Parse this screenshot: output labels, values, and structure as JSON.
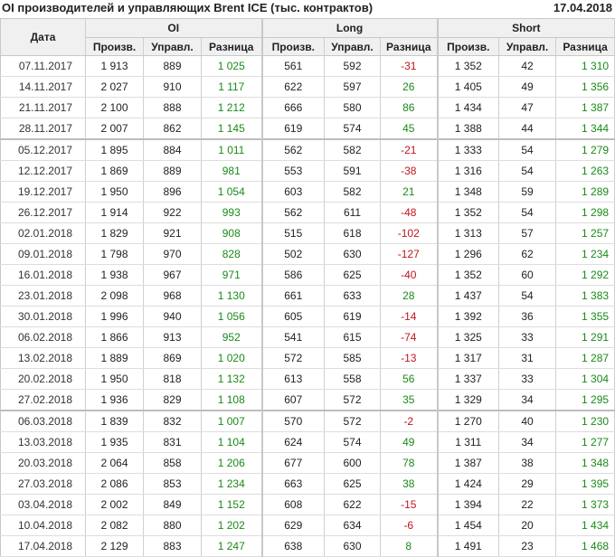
{
  "title": "OI производителей и управляющих Brent ICE (тыс. контрактов)",
  "date": "17.04.2018",
  "headers": {
    "date": "Дата",
    "oi": "OI",
    "long": "Long",
    "short": "Short",
    "prod": "Произв.",
    "manag": "Управл.",
    "diff": "Разница"
  },
  "colors": {
    "positive": "#1a8a1a",
    "negative": "#c0141c"
  },
  "rows": [
    {
      "date": "07.11.2017",
      "oi": [
        "1 913",
        "889",
        "1 025"
      ],
      "long": [
        "561",
        "592",
        "-31"
      ],
      "short": [
        "1 352",
        "42",
        "1 310"
      ]
    },
    {
      "date": "14.11.2017",
      "oi": [
        "2 027",
        "910",
        "1 117"
      ],
      "long": [
        "622",
        "597",
        "26"
      ],
      "short": [
        "1 405",
        "49",
        "1 356"
      ]
    },
    {
      "date": "21.11.2017",
      "oi": [
        "2 100",
        "888",
        "1 212"
      ],
      "long": [
        "666",
        "580",
        "86"
      ],
      "short": [
        "1 434",
        "47",
        "1 387"
      ]
    },
    {
      "date": "28.11.2017",
      "oi": [
        "2 007",
        "862",
        "1 145"
      ],
      "long": [
        "619",
        "574",
        "45"
      ],
      "short": [
        "1 388",
        "44",
        "1 344"
      ]
    },
    {
      "date": "05.12.2017",
      "oi": [
        "1 895",
        "884",
        "1 011"
      ],
      "long": [
        "562",
        "582",
        "-21"
      ],
      "short": [
        "1 333",
        "54",
        "1 279"
      ],
      "sep": true
    },
    {
      "date": "12.12.2017",
      "oi": [
        "1 869",
        "889",
        "981"
      ],
      "long": [
        "553",
        "591",
        "-38"
      ],
      "short": [
        "1 316",
        "54",
        "1 263"
      ]
    },
    {
      "date": "19.12.2017",
      "oi": [
        "1 950",
        "896",
        "1 054"
      ],
      "long": [
        "603",
        "582",
        "21"
      ],
      "short": [
        "1 348",
        "59",
        "1 289"
      ]
    },
    {
      "date": "26.12.2017",
      "oi": [
        "1 914",
        "922",
        "993"
      ],
      "long": [
        "562",
        "611",
        "-48"
      ],
      "short": [
        "1 352",
        "54",
        "1 298"
      ]
    },
    {
      "date": "02.01.2018",
      "oi": [
        "1 829",
        "921",
        "908"
      ],
      "long": [
        "515",
        "618",
        "-102"
      ],
      "short": [
        "1 313",
        "57",
        "1 257"
      ]
    },
    {
      "date": "09.01.2018",
      "oi": [
        "1 798",
        "970",
        "828"
      ],
      "long": [
        "502",
        "630",
        "-127"
      ],
      "short": [
        "1 296",
        "62",
        "1 234"
      ]
    },
    {
      "date": "16.01.2018",
      "oi": [
        "1 938",
        "967",
        "971"
      ],
      "long": [
        "586",
        "625",
        "-40"
      ],
      "short": [
        "1 352",
        "60",
        "1 292"
      ]
    },
    {
      "date": "23.01.2018",
      "oi": [
        "2 098",
        "968",
        "1 130"
      ],
      "long": [
        "661",
        "633",
        "28"
      ],
      "short": [
        "1 437",
        "54",
        "1 383"
      ]
    },
    {
      "date": "30.01.2018",
      "oi": [
        "1 996",
        "940",
        "1 056"
      ],
      "long": [
        "605",
        "619",
        "-14"
      ],
      "short": [
        "1 392",
        "36",
        "1 355"
      ]
    },
    {
      "date": "06.02.2018",
      "oi": [
        "1 866",
        "913",
        "952"
      ],
      "long": [
        "541",
        "615",
        "-74"
      ],
      "short": [
        "1 325",
        "33",
        "1 291"
      ]
    },
    {
      "date": "13.02.2018",
      "oi": [
        "1 889",
        "869",
        "1 020"
      ],
      "long": [
        "572",
        "585",
        "-13"
      ],
      "short": [
        "1 317",
        "31",
        "1 287"
      ]
    },
    {
      "date": "20.02.2018",
      "oi": [
        "1 950",
        "818",
        "1 132"
      ],
      "long": [
        "613",
        "558",
        "56"
      ],
      "short": [
        "1 337",
        "33",
        "1 304"
      ]
    },
    {
      "date": "27.02.2018",
      "oi": [
        "1 936",
        "829",
        "1 108"
      ],
      "long": [
        "607",
        "572",
        "35"
      ],
      "short": [
        "1 329",
        "34",
        "1 295"
      ]
    },
    {
      "date": "06.03.2018",
      "oi": [
        "1 839",
        "832",
        "1 007"
      ],
      "long": [
        "570",
        "572",
        "-2"
      ],
      "short": [
        "1 270",
        "40",
        "1 230"
      ],
      "sep": true
    },
    {
      "date": "13.03.2018",
      "oi": [
        "1 935",
        "831",
        "1 104"
      ],
      "long": [
        "624",
        "574",
        "49"
      ],
      "short": [
        "1 311",
        "34",
        "1 277"
      ]
    },
    {
      "date": "20.03.2018",
      "oi": [
        "2 064",
        "858",
        "1 206"
      ],
      "long": [
        "677",
        "600",
        "78"
      ],
      "short": [
        "1 387",
        "38",
        "1 348"
      ]
    },
    {
      "date": "27.03.2018",
      "oi": [
        "2 086",
        "853",
        "1 234"
      ],
      "long": [
        "663",
        "625",
        "38"
      ],
      "short": [
        "1 424",
        "29",
        "1 395"
      ]
    },
    {
      "date": "03.04.2018",
      "oi": [
        "2 002",
        "849",
        "1 152"
      ],
      "long": [
        "608",
        "622",
        "-15"
      ],
      "short": [
        "1 394",
        "22",
        "1 373"
      ]
    },
    {
      "date": "10.04.2018",
      "oi": [
        "2 082",
        "880",
        "1 202"
      ],
      "long": [
        "629",
        "634",
        "-6"
      ],
      "short": [
        "1 454",
        "20",
        "1 434"
      ]
    },
    {
      "date": "17.04.2018",
      "oi": [
        "2 129",
        "883",
        "1 247"
      ],
      "long": [
        "638",
        "630",
        "8"
      ],
      "short": [
        "1 491",
        "23",
        "1 468"
      ]
    }
  ]
}
